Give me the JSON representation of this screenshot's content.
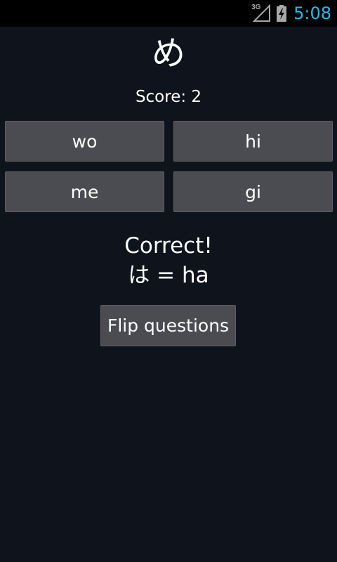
{
  "status_bar": {
    "network_label": "3G",
    "time": "5:08",
    "clock_color": "#33b5e5",
    "icons": [
      "signal-3g-icon",
      "battery-charging-icon"
    ]
  },
  "quiz": {
    "question_char": "め",
    "score_text": "Score: 2",
    "answers": [
      "wo",
      "hi",
      "me",
      "gi"
    ],
    "result_title": "Correct!",
    "result_detail": "は = ha",
    "flip_label": "Flip questions"
  },
  "colors": {
    "background": "#0f131c",
    "button_bg": "#4b4c52",
    "status_bar_bg": "#000000"
  }
}
